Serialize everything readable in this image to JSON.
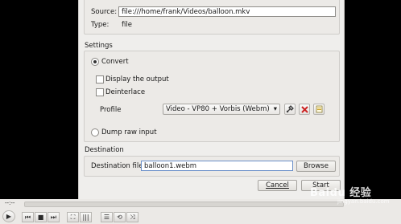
{
  "source": {
    "label": "Source:",
    "value": "file:///home/frank/Videos/balloon.mkv",
    "type_label": "Type:",
    "type_value": "file"
  },
  "settings": {
    "title": "Settings",
    "convert_label": "Convert",
    "display_output_label": "Display the output",
    "deinterlace_label": "Deinterlace",
    "profile_label": "Profile",
    "profile_value": "Video - VP80 + Vorbis (Webm)",
    "dump_raw_label": "Dump raw input"
  },
  "destination": {
    "title": "Destination",
    "file_label": "Destination file:",
    "file_value": "balloon1.webm",
    "browse_label": "Browse"
  },
  "buttons": {
    "cancel_label": "Cancel",
    "start_label": "Start"
  },
  "player": {
    "time_label": "--:--"
  },
  "watermark": {
    "brand": "Baidu 经验",
    "url": "jingyan.baidu.com"
  },
  "colors": {
    "accent": "#6a8fc9",
    "delete_red": "#cc2222"
  }
}
